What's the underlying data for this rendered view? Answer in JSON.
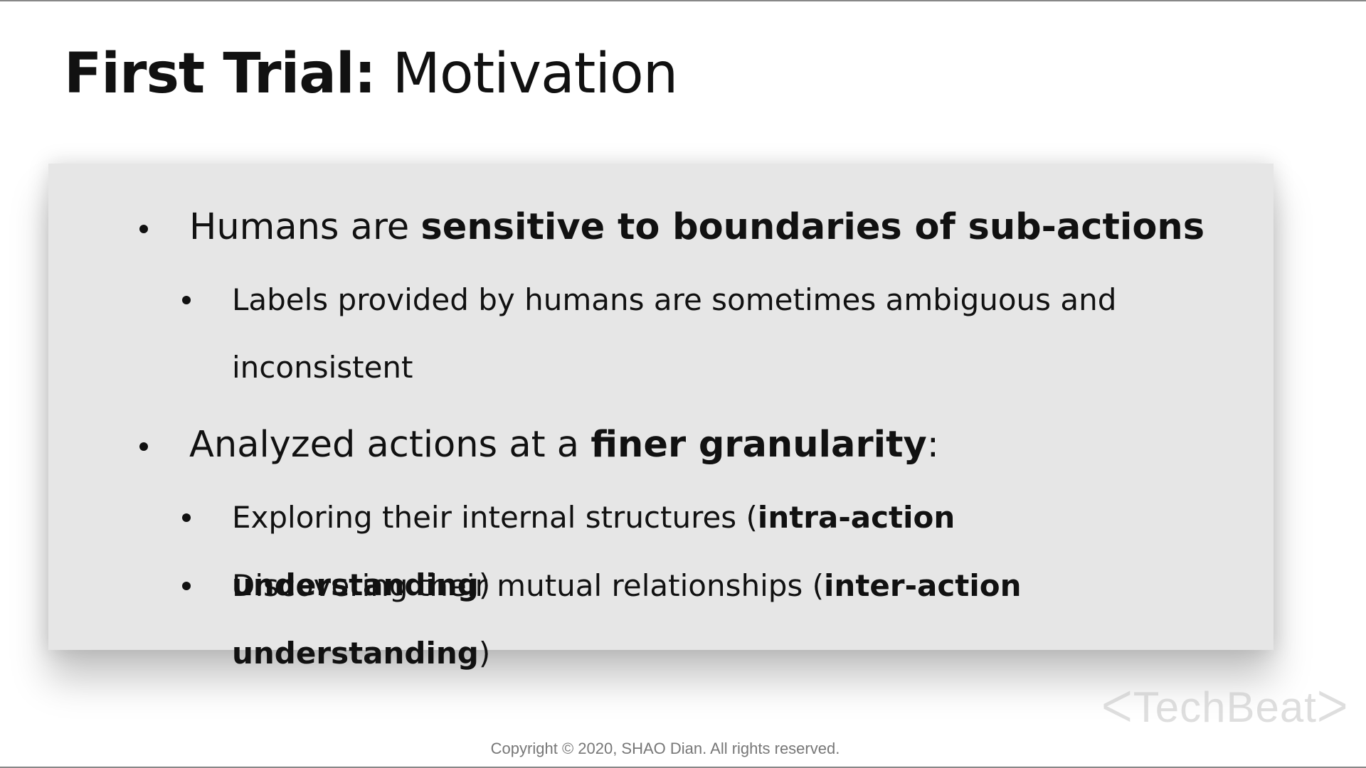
{
  "slide": {
    "title_bold": "First Trial:",
    "title_rest": " Motivation",
    "bullets": [
      {
        "level": 1,
        "segments": [
          {
            "text": "Humans are ",
            "bold": false
          },
          {
            "text": "sensitive to boundaries of sub-actions",
            "bold": true
          }
        ]
      },
      {
        "level": 2,
        "segments": [
          {
            "text": "Labels provided by humans are sometimes ambiguous and inconsistent",
            "bold": false
          }
        ]
      },
      {
        "level": 1,
        "segments": [
          {
            "text": "Analyzed actions at a ",
            "bold": false
          },
          {
            "text": "finer granularity",
            "bold": true
          },
          {
            "text": ":",
            "bold": false
          }
        ]
      },
      {
        "level": 2,
        "segments": [
          {
            "text": "Exploring their internal structures (",
            "bold": false
          },
          {
            "text": "intra-action understanding",
            "bold": true
          },
          {
            "text": ")",
            "bold": false
          }
        ]
      },
      {
        "level": 2,
        "segments": [
          {
            "text": "Discovering their mutual relationships (",
            "bold": false
          },
          {
            "text": "inter-action understanding",
            "bold": true
          },
          {
            "text": ")",
            "bold": false
          }
        ]
      }
    ]
  },
  "watermark": "ᐸTechBeatᐳ",
  "copyright": "Copyright © 2020, SHAO Dian. All rights reserved."
}
